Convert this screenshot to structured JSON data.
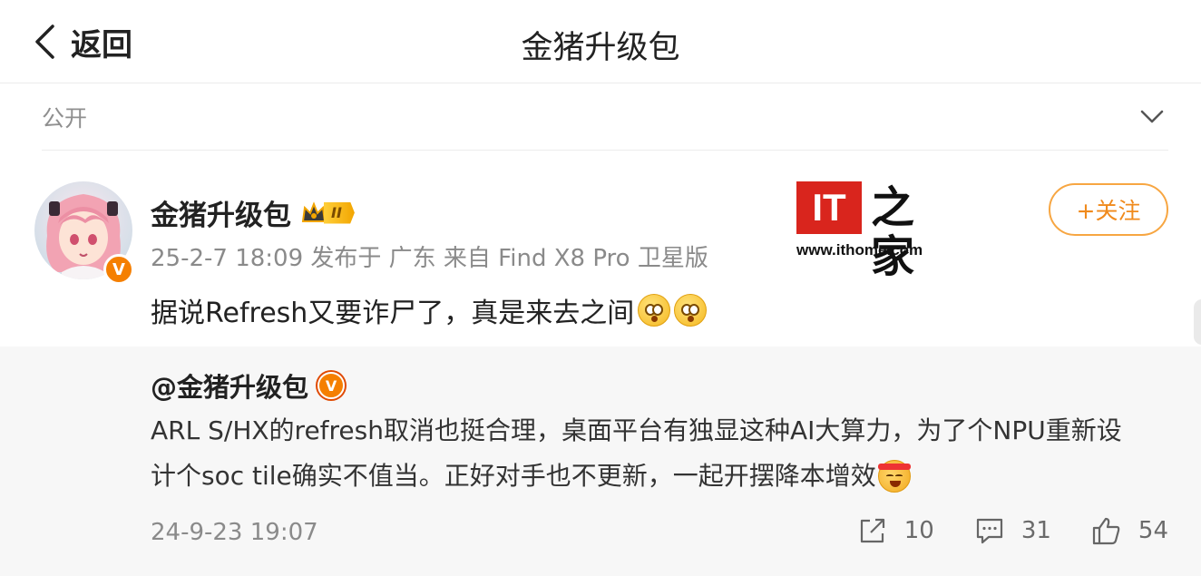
{
  "navbar": {
    "back_label": "返回",
    "title": "金猪升级包"
  },
  "visibility": {
    "label": "公开"
  },
  "post": {
    "username": "金猪升级包",
    "level_badge": "II",
    "meta": "25-2-7 18:09 发布于 广东 来自 Find X8 Pro 卫星版",
    "content": "据说Refresh又要诈尸了，真是来去之间",
    "follow_label": "+关注",
    "verified_mark": "V"
  },
  "watermark": {
    "logo_text": "IT",
    "zh_text": "之家",
    "url": "www.ithome.com"
  },
  "repost": {
    "username": "@金猪升级包",
    "verified_mark": "V",
    "text_line1": "ARL S/HX的refresh取消也挺合理，桌面平台有独显这种AI大算力，为了个NPU重新设",
    "text_line2": "计个soc tile确实不值当。正好对手也不更新，一起开摆降本增效",
    "time": "24-9-23 19:07",
    "share_count": "10",
    "comment_count": "31",
    "like_count": "54"
  },
  "colors": {
    "accent": "#f08a1c",
    "verified": "#f57f00",
    "repost_bg": "#f7f7f7"
  }
}
